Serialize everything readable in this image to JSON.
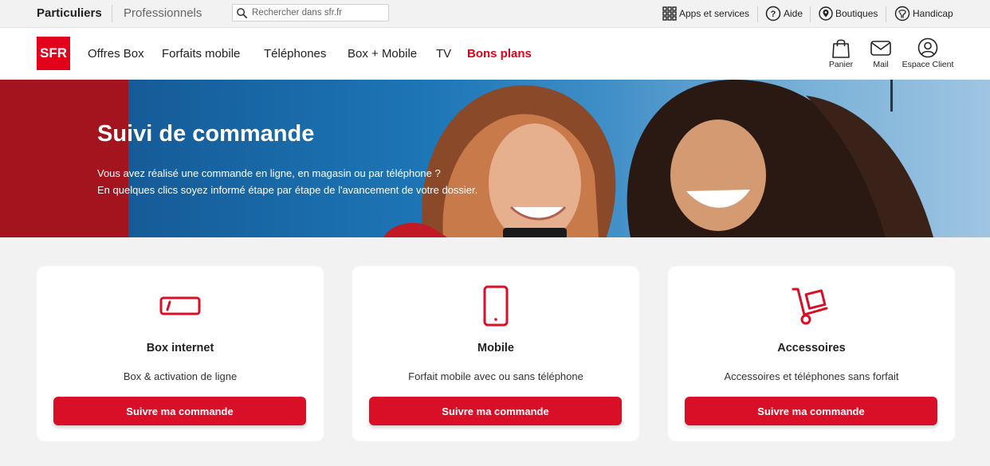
{
  "utility": {
    "tab_particuliers": "Particuliers",
    "tab_professionnels": "Professionnels",
    "search_placeholder": "Rechercher dans sfr.fr",
    "apps": "Apps et services",
    "aide": "Aide",
    "boutiques": "Boutiques",
    "handicap": "Handicap"
  },
  "nav": {
    "logo": "SFR",
    "items": [
      "Offres Box",
      "Forfaits mobile",
      "Téléphones",
      "Box + Mobile",
      "TV",
      "Bons plans"
    ],
    "panier": "Panier",
    "mail": "Mail",
    "espace_client": "Espace Client"
  },
  "hero": {
    "title": "Suivi de commande",
    "line1": "Vous avez réalisé une commande en ligne, en magasin ou par téléphone ?",
    "line2": "En quelques clics soyez informé étape par étape de l'avancement de votre dossier."
  },
  "cards": [
    {
      "title": "Box internet",
      "desc": "Box & activation de ligne",
      "button": "Suivre ma commande",
      "icon": "box-internet-icon"
    },
    {
      "title": "Mobile",
      "desc": "Forfait mobile avec ou sans téléphone",
      "button": "Suivre ma commande",
      "icon": "mobile-phone-icon"
    },
    {
      "title": "Accessoires",
      "desc": "Accessoires et téléphones sans forfait",
      "button": "Suivre ma commande",
      "icon": "hand-truck-icon"
    }
  ],
  "colors": {
    "brand_red": "#e2001a",
    "button_red": "#d80f27",
    "hero_dark_red": "#a3141f",
    "hero_blue": "#1a6eab"
  }
}
